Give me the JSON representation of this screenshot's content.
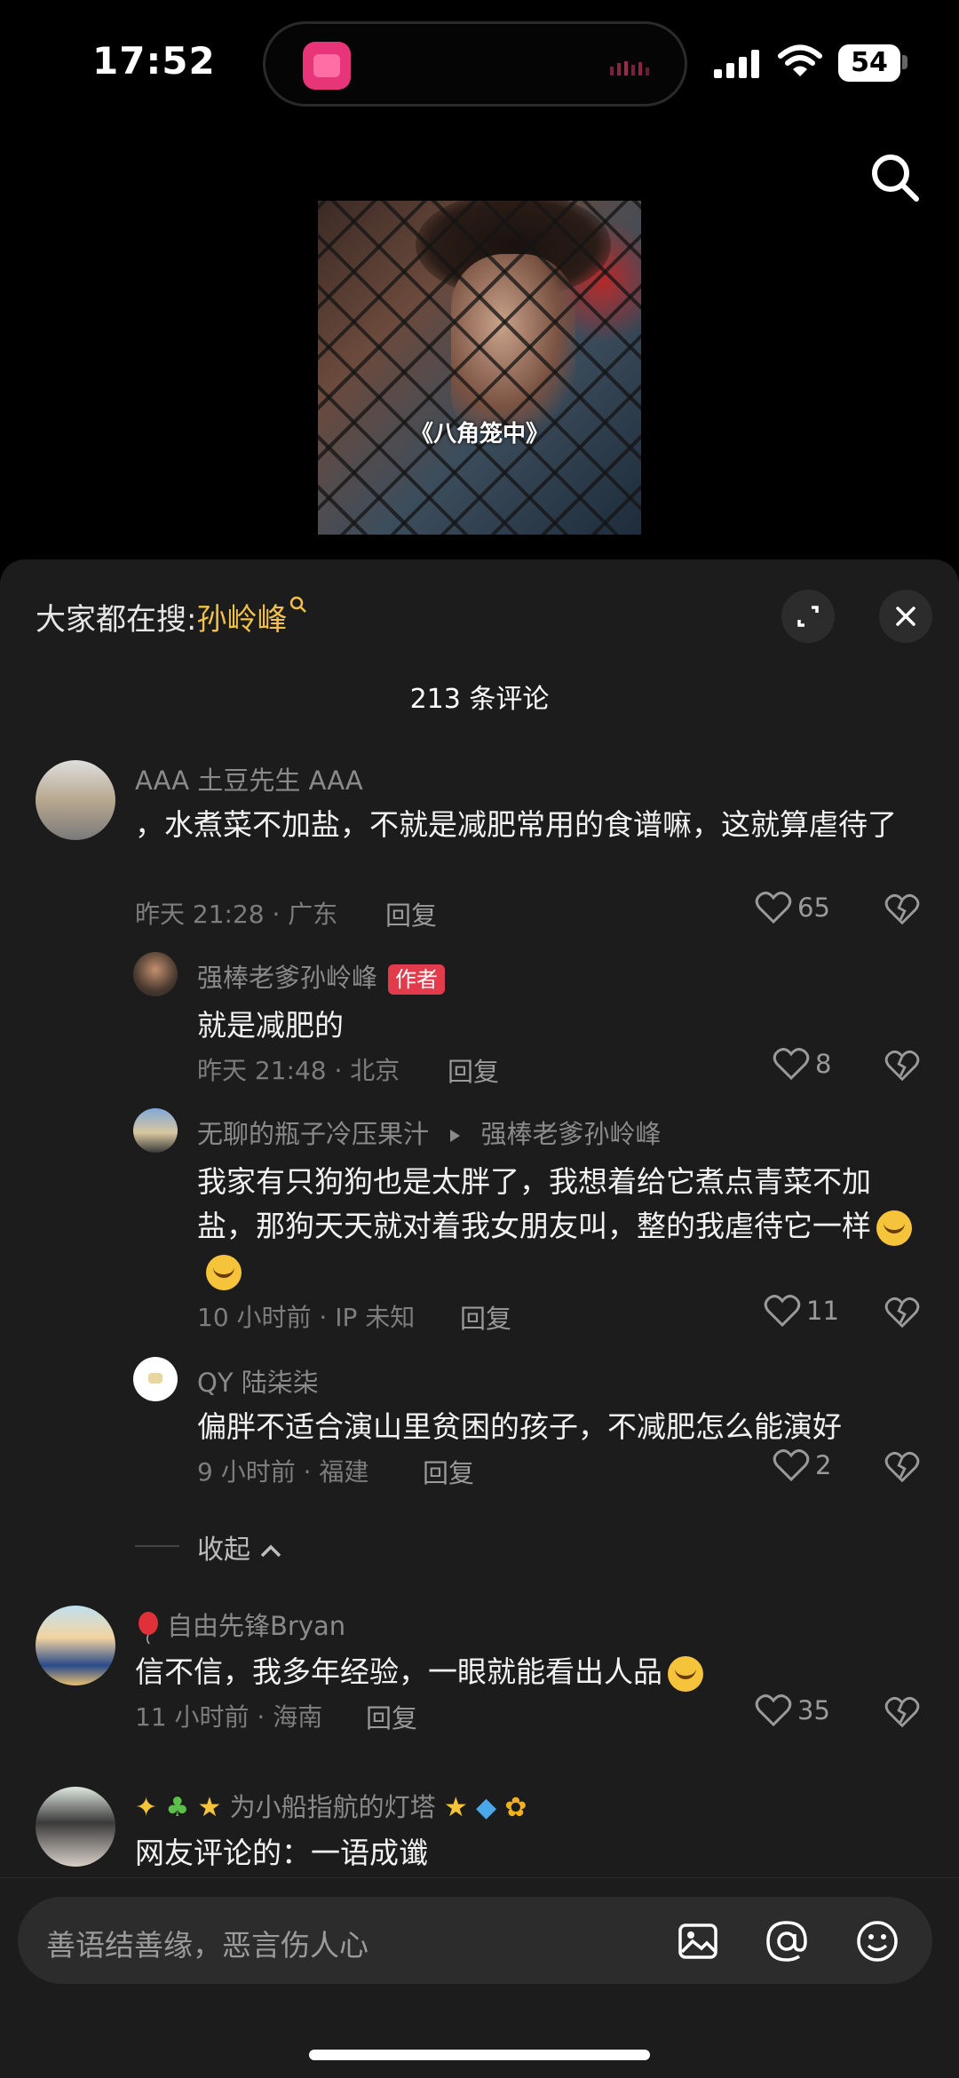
{
  "status_bar": {
    "time": "17:52",
    "battery": "54"
  },
  "video": {
    "caption": "《八角笼中》"
  },
  "header": {
    "hot_label": "大家都在搜:",
    "hot_term": "孙岭峰",
    "comment_count": "213 条评论"
  },
  "comments": [
    {
      "user": "AAA 土豆先生 AAA",
      "text": "，水煮菜不加盐，不就是减肥常用的食谱嘛，这就算虐待了",
      "meta": "昨天 21:28 · 广东",
      "reply": "回复",
      "likes": "65"
    },
    {
      "user": "强棒老爹孙岭峰",
      "badge": "作者",
      "text": "就是减肥的",
      "meta": "昨天 21:48 · 北京",
      "reply": "回复",
      "likes": "8"
    },
    {
      "user": "无聊的瓶子冷压果汁",
      "reply_to": "强棒老爹孙岭峰",
      "text": "我家有只狗狗也是太胖了，我想着给它煮点青菜不加盐，那狗天天就对着我女朋友叫，整的我虐待它一样",
      "meta": "10 小时前 · IP 未知",
      "reply": "回复",
      "likes": "11"
    },
    {
      "user": "QY 陆柒柒",
      "text": "偏胖不适合演山里贫困的孩子，不减肥怎么能演好",
      "meta": "9 小时前 · 福建",
      "reply": "回复",
      "likes": "2"
    },
    {
      "user": "自由先锋Bryan",
      "text": "信不信，我多年经验，一眼就能看出人品",
      "meta": "11 小时前 · 海南",
      "reply": "回复",
      "likes": "35"
    },
    {
      "user": "为小船指航的灯塔",
      "text": "网友评论的：一语成谶"
    }
  ],
  "collapse_label": "收起",
  "input": {
    "placeholder": "善语结善缘，恶言伤人心"
  }
}
